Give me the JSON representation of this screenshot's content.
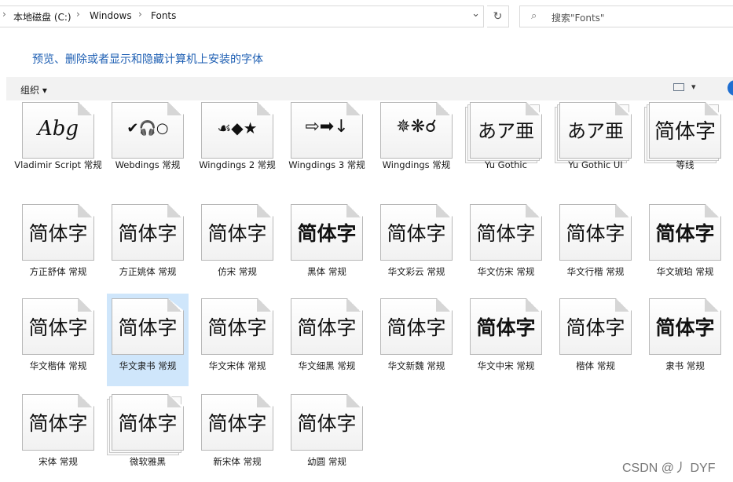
{
  "breadcrumb": [
    "本地磁盘 (C:)",
    "Windows",
    "Fonts"
  ],
  "search_placeholder": "搜索\"Fonts\"",
  "heading": "预览、删除或者显示和隐藏计算机上安装的字体",
  "toolbar": {
    "organize": "组织 ▾",
    "view_dropdown": "▾",
    "help": "?"
  },
  "fonts": [
    {
      "name": "Vladimir Script 常规",
      "sample": "Abg"
    },
    {
      "name": "Webdings 常规",
      "sample": "✔🎧○"
    },
    {
      "name": "Wingdings 2 常规",
      "sample": "☙◆★"
    },
    {
      "name": "Wingdings 3 常规",
      "sample": "⇨➡↓"
    },
    {
      "name": "Wingdings 常规",
      "sample": "✵❋☌"
    },
    {
      "name": "Yu Gothic",
      "sample": "あア亜"
    },
    {
      "name": "Yu Gothic UI",
      "sample": "あア亜"
    },
    {
      "name": "等线",
      "sample": "简体字"
    },
    {
      "name": "方正舒体 常规",
      "sample": "简体字"
    },
    {
      "name": "方正姚体 常规",
      "sample": "简体字"
    },
    {
      "name": "仿宋 常规",
      "sample": "简体字"
    },
    {
      "name": "黑体 常规",
      "sample": "简体字"
    },
    {
      "name": "华文彩云 常规",
      "sample": "简体字"
    },
    {
      "name": "华文仿宋 常规",
      "sample": "简体字"
    },
    {
      "name": "华文行楷 常规",
      "sample": "简体字"
    },
    {
      "name": "华文琥珀 常规",
      "sample": "简体字"
    },
    {
      "name": "华文楷体 常规",
      "sample": "简体字"
    },
    {
      "name": "华文隶书 常规",
      "sample": "简体字"
    },
    {
      "name": "华文宋体 常规",
      "sample": "简体字"
    },
    {
      "name": "华文细黑 常规",
      "sample": "简体字"
    },
    {
      "name": "华文新魏 常规",
      "sample": "简体字"
    },
    {
      "name": "华文中宋 常规",
      "sample": "简体字"
    },
    {
      "name": "楷体 常规",
      "sample": "简体字"
    },
    {
      "name": "隶书 常规",
      "sample": "简体字"
    },
    {
      "name": "宋体 常规",
      "sample": "简体字"
    },
    {
      "name": "微软雅黑",
      "sample": "简体字"
    },
    {
      "name": "新宋体 常规",
      "sample": "简体字"
    },
    {
      "name": "幼圆 常规",
      "sample": "简体字"
    }
  ],
  "watermark": "CSDN @丿 DYF"
}
